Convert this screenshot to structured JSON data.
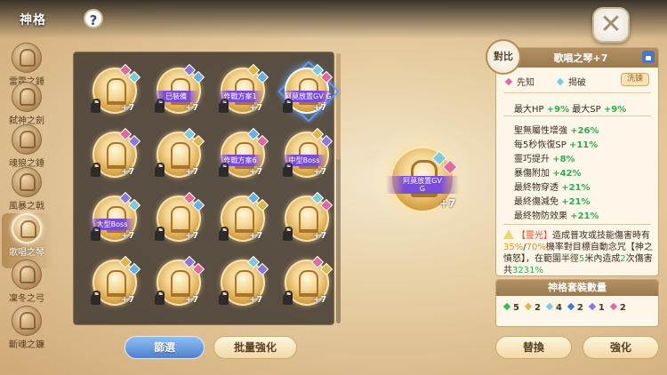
{
  "header": {
    "title": "神格",
    "help_label": "?",
    "close_label": "✕"
  },
  "sidebar": {
    "items": [
      {
        "label": "雷霆之錘",
        "active": false
      },
      {
        "label": "弑神之劍",
        "active": false
      },
      {
        "label": "魂狼之錘",
        "active": false
      },
      {
        "label": "風暴之戟",
        "active": false
      },
      {
        "label": "歌唱之琴",
        "active": true
      },
      {
        "label": "凜冬之弓",
        "active": false
      },
      {
        "label": "斷魂之鐮",
        "active": false
      }
    ]
  },
  "grid": {
    "cards": [
      {
        "tag": "",
        "plus": "+7",
        "locked": true,
        "b1": "#e06a9c",
        "b2": "#7fc9d8"
      },
      {
        "tag": "已裝備",
        "plus": "+7",
        "locked": true,
        "b1": "#8a79d8",
        "b2": "#6ab0e0"
      },
      {
        "tag": "作戰方案1",
        "plus": "+7",
        "locked": true,
        "b1": "#e0b54a",
        "b2": "#6ab0e0"
      },
      {
        "tag": "阿莫放置GV G",
        "plus": "+7",
        "locked": true,
        "selected": true,
        "b1": "#7fc9d8",
        "b2": "#e06a9c"
      },
      {
        "tag": "",
        "plus": "+7",
        "locked": true,
        "b1": "#e06a9c",
        "b2": "#8a79d8"
      },
      {
        "tag": "",
        "plus": "+7",
        "locked": true,
        "b1": "#7fc9d8",
        "b2": "#e0b54a"
      },
      {
        "tag": "作戰方案6",
        "plus": "+7",
        "locked": true,
        "b1": "#6ab0e0",
        "b2": "#e06a9c"
      },
      {
        "tag": "中型Boss",
        "plus": "+7",
        "locked": true,
        "b1": "#e0b54a",
        "b2": "#8a79d8"
      },
      {
        "tag": "大型Boss",
        "plus": "+7",
        "locked": true,
        "b1": "#8a79d8",
        "b2": "#7fc9d8"
      },
      {
        "tag": "",
        "plus": "+7",
        "locked": true,
        "b1": "#e06a9c",
        "b2": "#6ab0e0"
      },
      {
        "tag": "",
        "plus": "+7",
        "locked": true,
        "b1": "#6ab0e0",
        "b2": "#e0b54a"
      },
      {
        "tag": "",
        "plus": "+7",
        "locked": true,
        "b1": "#7fc9d8",
        "b2": "#e06a9c"
      },
      {
        "tag": "",
        "plus": "+7",
        "locked": true,
        "b1": "#e0b54a",
        "b2": "#6ab0e0"
      },
      {
        "tag": "",
        "plus": "+7",
        "locked": true,
        "b1": "#8a79d8",
        "b2": "#e06a9c"
      },
      {
        "tag": "",
        "plus": "+7",
        "locked": true,
        "b1": "#7fc9d8",
        "b2": "#8a79d8"
      },
      {
        "tag": "",
        "plus": "+7",
        "locked": true,
        "b1": "#e06a9c",
        "b2": "#e0b54a"
      }
    ]
  },
  "buttons": {
    "filter": "篩選",
    "batch_enhance": "批量強化",
    "replace": "替換",
    "enhance": "強化",
    "compare": "對比"
  },
  "preview": {
    "tag_line1": "阿莫放置GV",
    "tag_line2": "G",
    "plus": "+7"
  },
  "info": {
    "name": "歌唱之琴+7",
    "skill1": "先知",
    "skill2": "揭破",
    "wash_label": "洗鍊",
    "main_stats": {
      "hp_label": "最大HP",
      "hp_value": "+9%",
      "sp_label": "最大SP",
      "sp_value": "+9%"
    },
    "stats": [
      {
        "label": "聖無屬性增強",
        "value": "+26%"
      },
      {
        "label": "每5秒恢復SP",
        "value": "+11%"
      },
      {
        "label": "靈巧提升",
        "value": "+8%"
      },
      {
        "label": "暴傷附加",
        "value": "+42%"
      },
      {
        "label": "最終物穿透",
        "value": "+21%"
      },
      {
        "label": "最終傷減免",
        "value": "+21%"
      },
      {
        "label": "最終物防效果",
        "value": "+21%"
      }
    ],
    "desc": {
      "k": "【靈光】",
      "t1": "造成普攻或技能傷害時有",
      "v1": "35%",
      "t1b": "/",
      "v2": "70%",
      "t2": "機率對目標自動念咒【神之憤怒】，在範圍半徑",
      "g1": "5",
      "t3": "米內造成",
      "g2": "2",
      "t4": "次傷害共",
      "g3": "3231%"
    }
  },
  "set": {
    "title": "神格套裝數量",
    "counts": [
      {
        "color": "#3fb85a",
        "n": "5"
      },
      {
        "color": "#e0b54a",
        "n": "2"
      },
      {
        "color": "#7fc9d8",
        "n": "4"
      },
      {
        "color": "#4a77c2",
        "n": "2"
      },
      {
        "color": "#8a79d8",
        "n": "1"
      },
      {
        "color": "#e06a9c",
        "n": "2"
      }
    ]
  }
}
